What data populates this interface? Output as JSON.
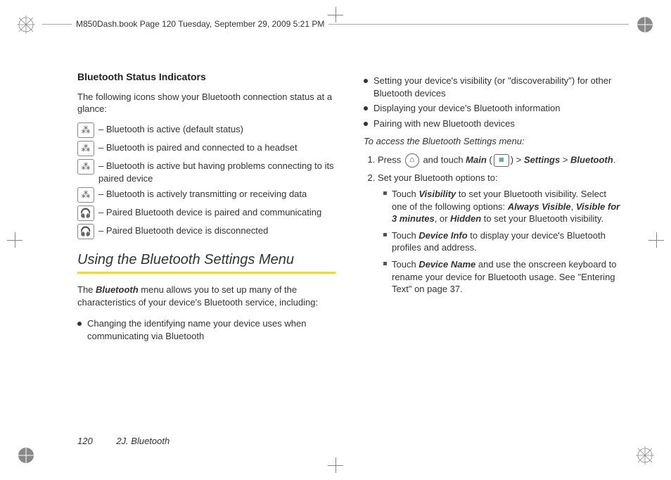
{
  "header": "M850Dash.book  Page 120  Tuesday, September 29, 2009  5:21 PM",
  "left": {
    "h3": "Bluetooth Status Indicators",
    "intro": "The following icons show your Bluetooth connection status at a glance:",
    "icons": [
      {
        "glyph": "⁂",
        "desc": "– Bluetooth is active (default status)"
      },
      {
        "glyph": "⁂",
        "desc": "– Bluetooth is paired and connected to a headset"
      },
      {
        "glyph": "⁂",
        "desc": "– Bluetooth is active but having problems connecting to its paired device"
      },
      {
        "glyph": "⁂",
        "desc": "– Bluetooth is actively transmitting or receiving data"
      },
      {
        "glyph": "🎧",
        "desc": "– Paired Bluetooth device is paired and communicating"
      },
      {
        "glyph": "🎧",
        "desc": "– Paired Bluetooth device is disconnected"
      }
    ],
    "section_title": "Using the Bluetooth Settings Menu",
    "section_intro_pre": "The ",
    "section_intro_em": "Bluetooth",
    "section_intro_post": " menu allows you to set up many of the characteristics of your device's Bluetooth service, including:",
    "b1": "Changing the identifying name your device uses when communicating via Bluetooth"
  },
  "right": {
    "bullets": [
      "Setting your device's visibility (or \"discoverability\") for other Bluetooth devices",
      "Displaying your device's Bluetooth information",
      "Pairing with new Bluetooth devices"
    ],
    "subhead": "To access the Bluetooth Settings menu:",
    "step1_pre": "Press ",
    "step1_mid": " and touch ",
    "step1_main": "Main",
    "step1_post1": " (",
    "step1_post2": ") > ",
    "step1_settings": "Settings",
    "step1_gt": " > ",
    "step1_bt": "Bluetooth",
    "step1_end": ".",
    "step2_intro": "Set your Bluetooth options to:",
    "sq": [
      {
        "pre": "Touch ",
        "em": "Visibility",
        "mid": " to set your Bluetooth visibility. Select one of the following options: ",
        "em2": "Always Visible",
        "c": ", ",
        "em3": "Visible for 3 minutes",
        "c2": ", or ",
        "em4": "Hidden",
        "post": " to set your Bluetooth visibility."
      },
      {
        "pre": "Touch ",
        "em": "Device Info",
        "post": " to display your device's Bluetooth profiles and address."
      },
      {
        "pre": "Touch ",
        "em": "Device Name",
        "post": " and use the onscreen keyboard to rename your device for Bluetooth usage. See \"Entering Text\" on page 37."
      }
    ]
  },
  "footer": {
    "page": "120",
    "section": "2J. Bluetooth"
  }
}
